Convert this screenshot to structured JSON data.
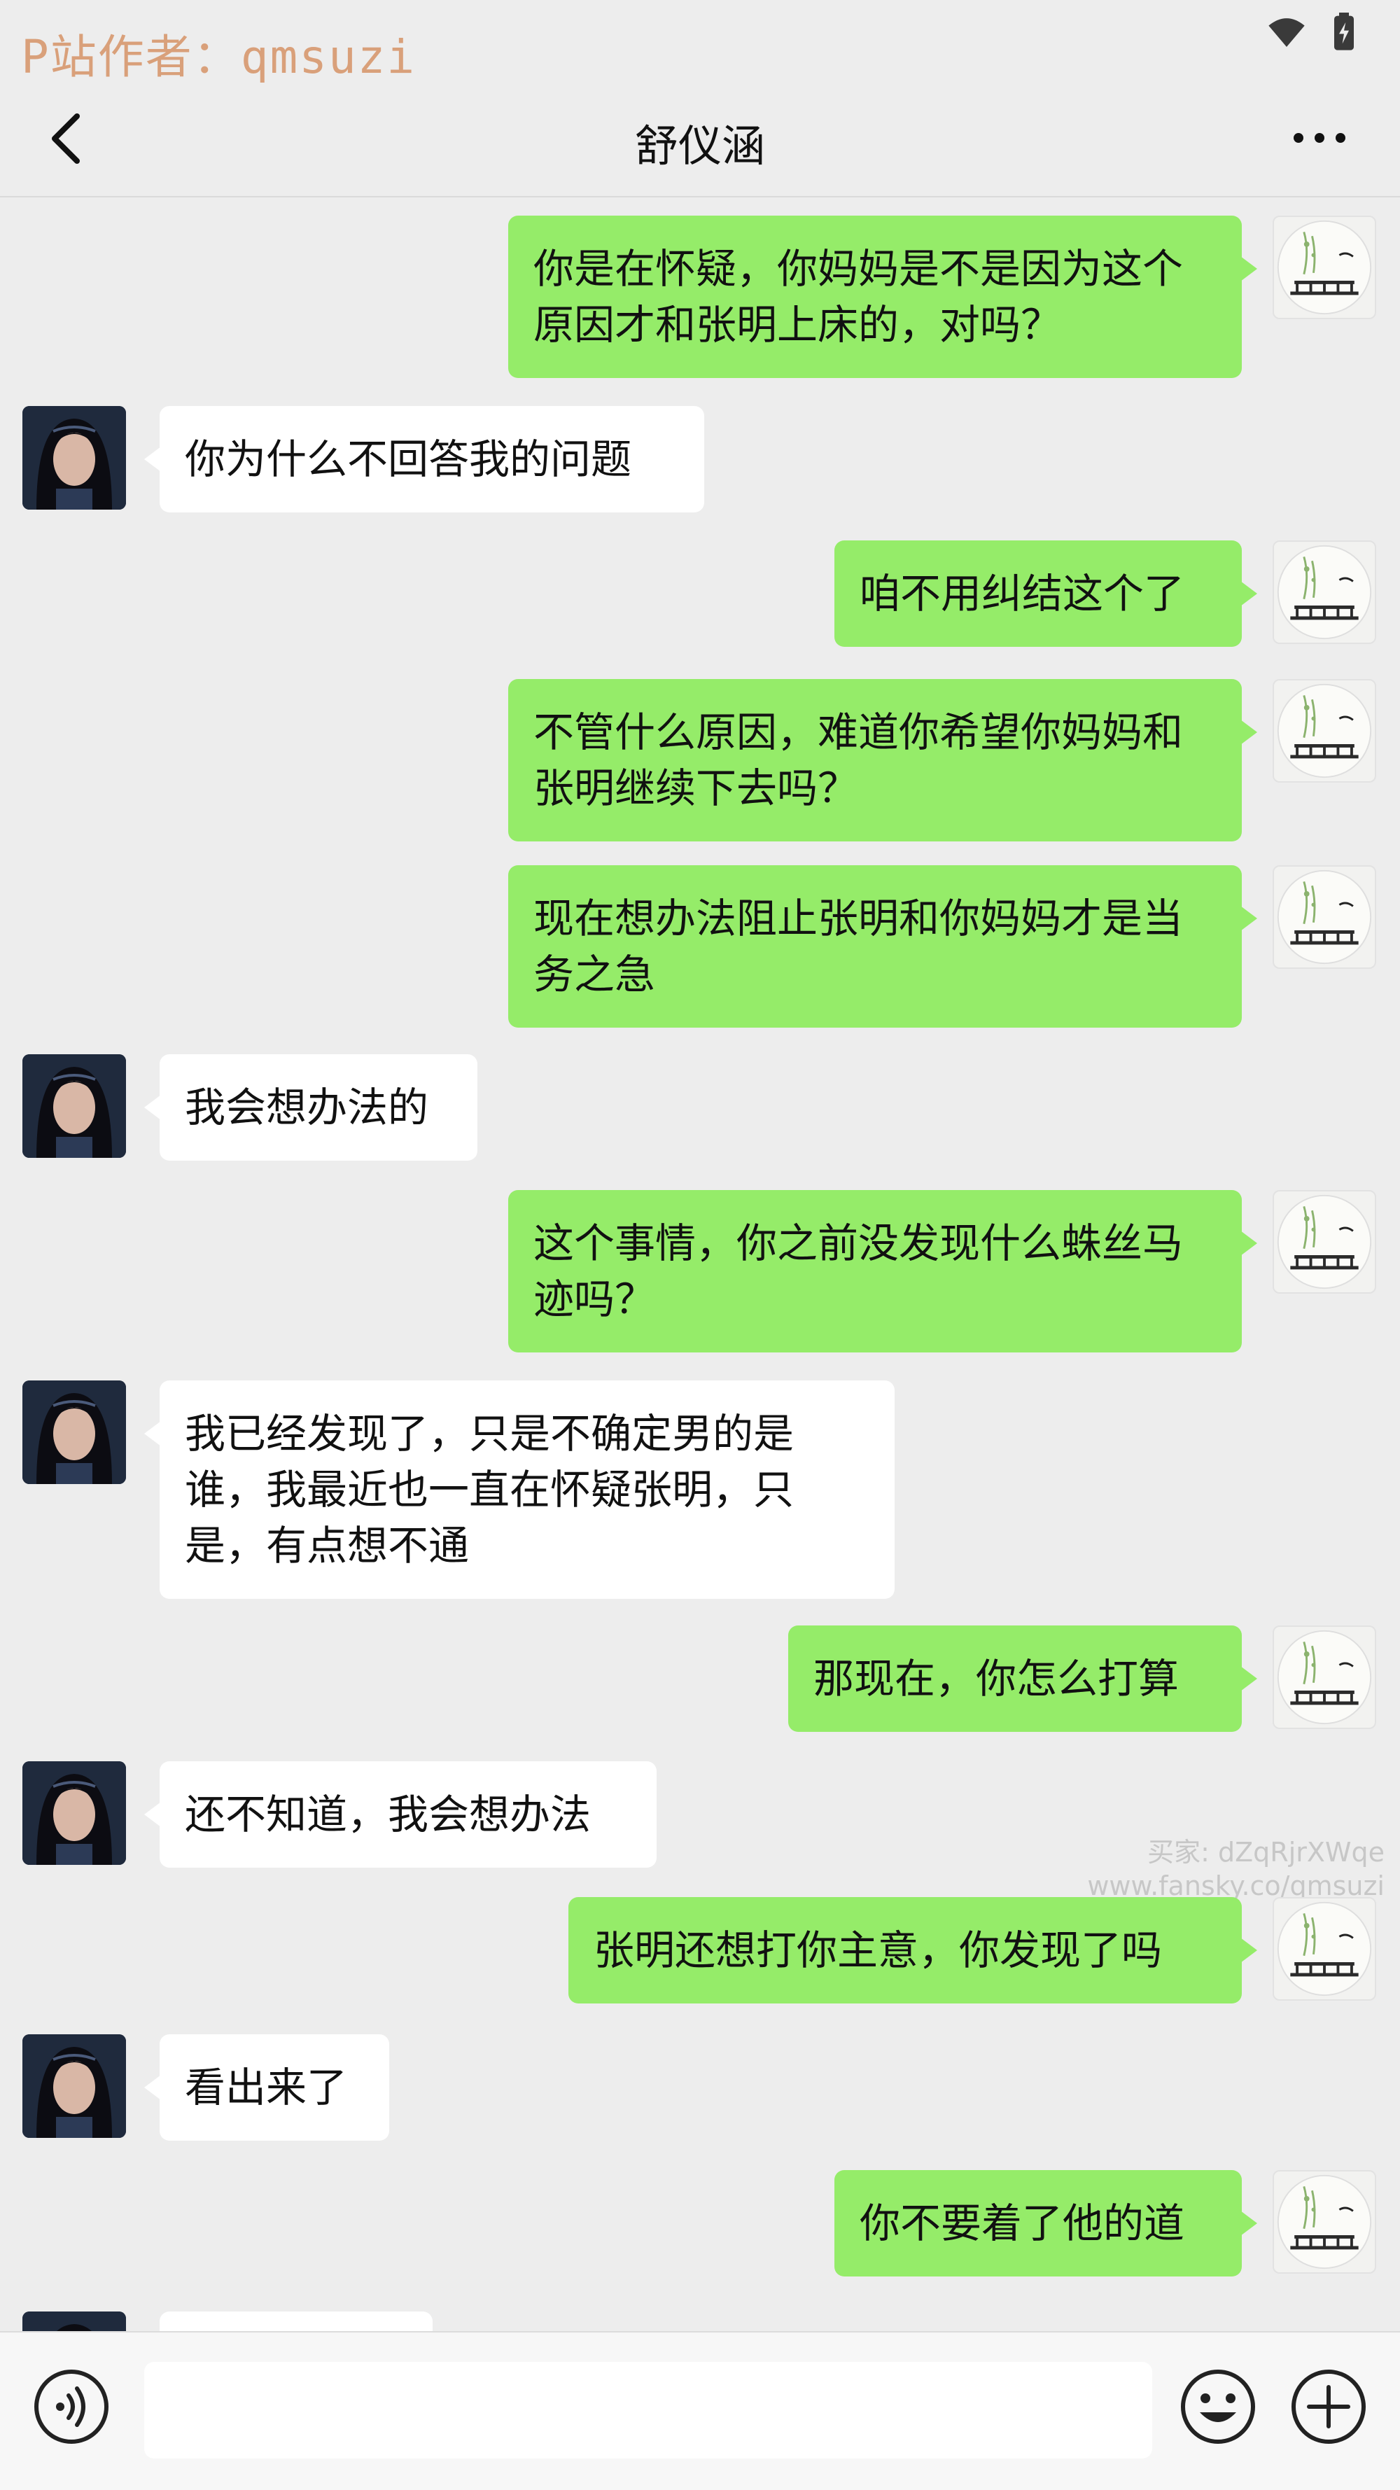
{
  "status_bar": {
    "watermark": "P站作者：qmsuzi",
    "icons": [
      "wifi-icon",
      "battery-charging-icon"
    ]
  },
  "nav": {
    "title": "舒仪涵",
    "back_icon": "chevron-left-icon",
    "more_icon": "more-dots-icon"
  },
  "messages": [
    {
      "from": "me",
      "text": "你是在怀疑，你妈妈是不是因为这个原因才和张明上床的，对吗？"
    },
    {
      "from": "other",
      "text": "你为什么不回答我的问题"
    },
    {
      "from": "me",
      "text": "咱不用纠结这个了"
    },
    {
      "from": "me",
      "text": "不管什么原因，难道你希望你妈妈和张明继续下去吗？"
    },
    {
      "from": "me",
      "text": "现在想办法阻止张明和你妈妈才是当务之急"
    },
    {
      "from": "other",
      "text": "我会想办法的"
    },
    {
      "from": "me",
      "text": "这个事情，你之前没发现什么蛛丝马迹吗？"
    },
    {
      "from": "other",
      "text": "我已经发现了，只是不确定男的是谁，我最近也一直在怀疑张明，只是，有点想不通"
    },
    {
      "from": "me",
      "text": "那现在，你怎么打算"
    },
    {
      "from": "other",
      "text": "还不知道，我会想办法"
    },
    {
      "from": "me",
      "text": "张明还想打你主意，你发现了吗"
    },
    {
      "from": "other",
      "text": "看出来了"
    },
    {
      "from": "me",
      "text": "你不要着了他的道"
    }
  ],
  "watermark_mid": {
    "line1": "买家: dZqRjrXWqe",
    "line2": "www.fansky.co/qmsuzi"
  },
  "input_bar": {
    "voice_icon": "voice-icon",
    "emoji_icon": "emoji-icon",
    "plus_icon": "plus-circle-icon",
    "input_value": ""
  },
  "colors": {
    "my_bubble": "#95ec69",
    "other_bubble": "#ffffff",
    "background": "#ededed"
  }
}
